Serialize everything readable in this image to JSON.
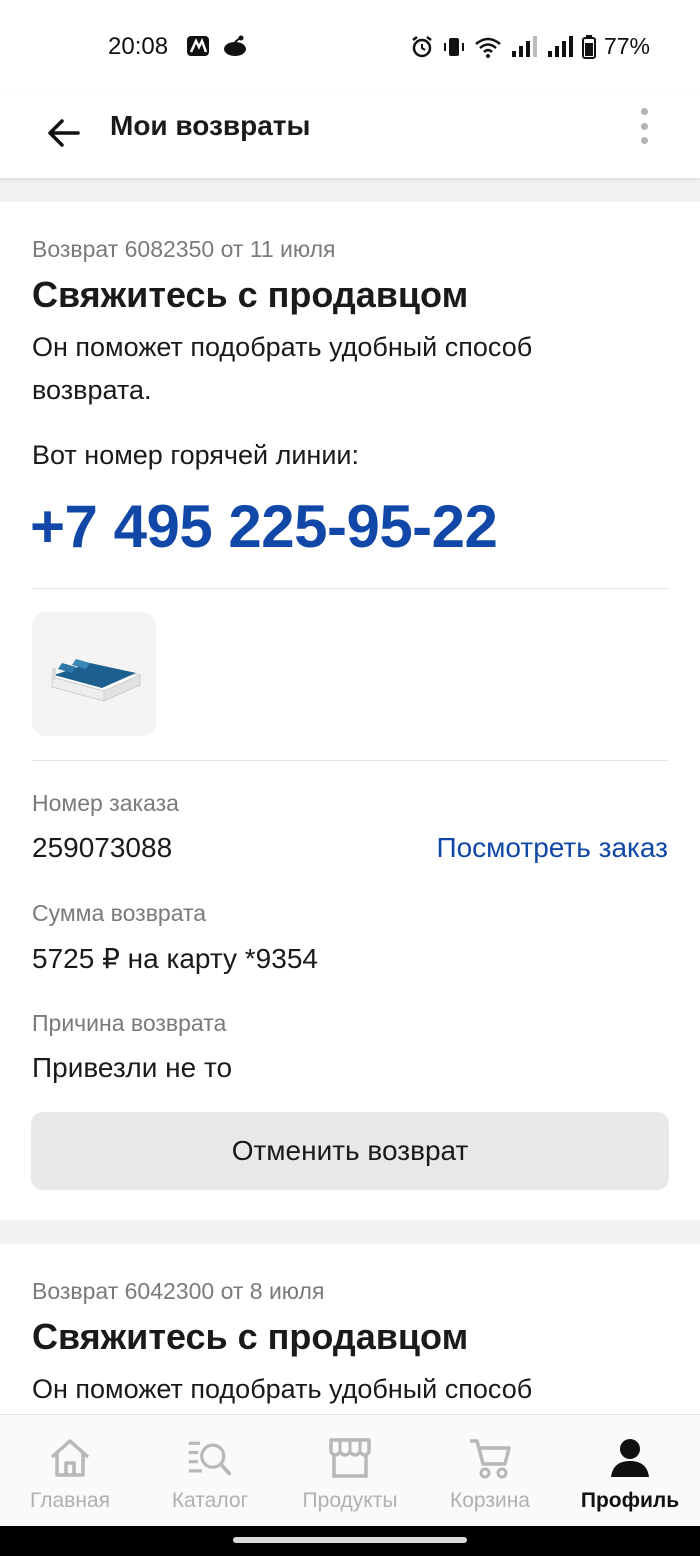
{
  "status": {
    "time": "20:08",
    "battery": "77%"
  },
  "header": {
    "title": "Мои возвраты"
  },
  "returns": [
    {
      "meta": "Возврат 6082350 от 11 июля",
      "heading": "Свяжитесь с продавцом",
      "text": "Он поможет подобрать удобный способ возврата.",
      "hotline_label": "Вот номер горячей линии:",
      "phone": "+7 495 225-95-22",
      "order_label": "Номер заказа",
      "order_number": "259073088",
      "view_order": "Посмотреть заказ",
      "amount_label": "Сумма возврата",
      "amount_value": "5725 ₽ на карту *9354",
      "reason_label": "Причина возврата",
      "reason_value": "Привезли не то",
      "cancel_label": "Отменить возврат"
    },
    {
      "meta": "Возврат 6042300 от 8 июля",
      "heading": "Свяжитесь с продавцом",
      "text": "Он поможет подобрать удобный способ"
    }
  ],
  "nav": {
    "items": [
      {
        "label": "Главная",
        "icon": "home-icon"
      },
      {
        "label": "Каталог",
        "icon": "catalog-search-icon"
      },
      {
        "label": "Продукты",
        "icon": "store-icon"
      },
      {
        "label": "Корзина",
        "icon": "cart-icon"
      },
      {
        "label": "Профиль",
        "icon": "profile-icon"
      }
    ],
    "active_index": 4
  },
  "colors": {
    "link": "#1148a8",
    "button_bg": "#e8e8e8",
    "muted": "#7a7a7a"
  }
}
